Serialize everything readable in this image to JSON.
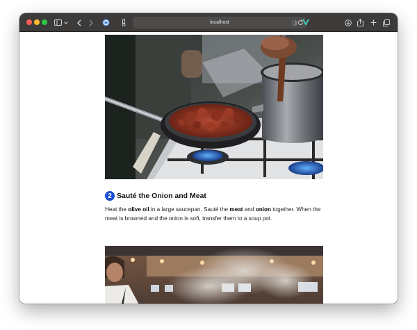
{
  "browser": {
    "url": "localhost",
    "traffic_lights": {
      "close": "#ff5f57",
      "minimize": "#febc2e",
      "zoom": "#28c840"
    },
    "toolbar_icons": [
      "sidebar-icon",
      "chevron-down-icon",
      "back-icon",
      "forward-icon",
      "privacy-shield-icon",
      "extension-icon",
      "reload-icon",
      "reader-icon",
      "vue-devtools-icon",
      "download-icon",
      "share-icon",
      "new-tab-icon",
      "tabs-overview-icon"
    ]
  },
  "recipe": {
    "step": {
      "number": "2",
      "title": "Sauté the Onion and Meat",
      "text_parts": {
        "p1": "Heat the ",
        "b1": "olive oil",
        "p2": " in a large saucepan. Sauté the ",
        "b2": "meat",
        "p3": " and ",
        "b3": "onion",
        "p4": " together. When the meat is browned and the onion is soft, transfer them to a soup pot."
      }
    }
  },
  "colors": {
    "accent": "#1a4fd6",
    "toolbar": "#3d3b3a"
  }
}
